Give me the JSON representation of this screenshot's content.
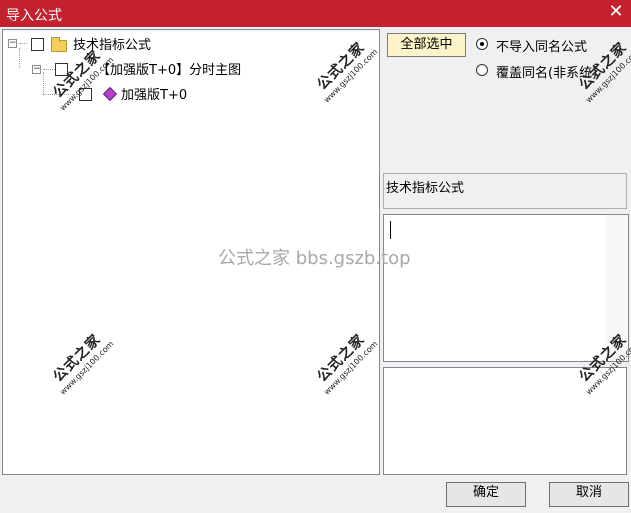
{
  "window": {
    "title": "导入公式",
    "close_symbol": "✕"
  },
  "tree": {
    "root": {
      "label": "技术指标公式",
      "expander": "−"
    },
    "child": {
      "label": "【加强版T+0】分时主图",
      "expander": "−"
    },
    "leaf": {
      "label": "加强版T+0"
    }
  },
  "buttons": {
    "select_all": "全部选中",
    "ok": "确定",
    "cancel": "取消"
  },
  "options": [
    {
      "label": "不导入同名公式",
      "checked": true
    },
    {
      "label": "覆盖同名(非系统)",
      "checked": false
    }
  ],
  "formula_type": "技术指标公式",
  "watermark": {
    "text": "公式之家",
    "url": "www.gszj100.com",
    "center": "公式之家 bbs.gszb.top"
  },
  "colors": {
    "titlebar": "#c4212f",
    "accent_button": "#fdf3c8"
  }
}
